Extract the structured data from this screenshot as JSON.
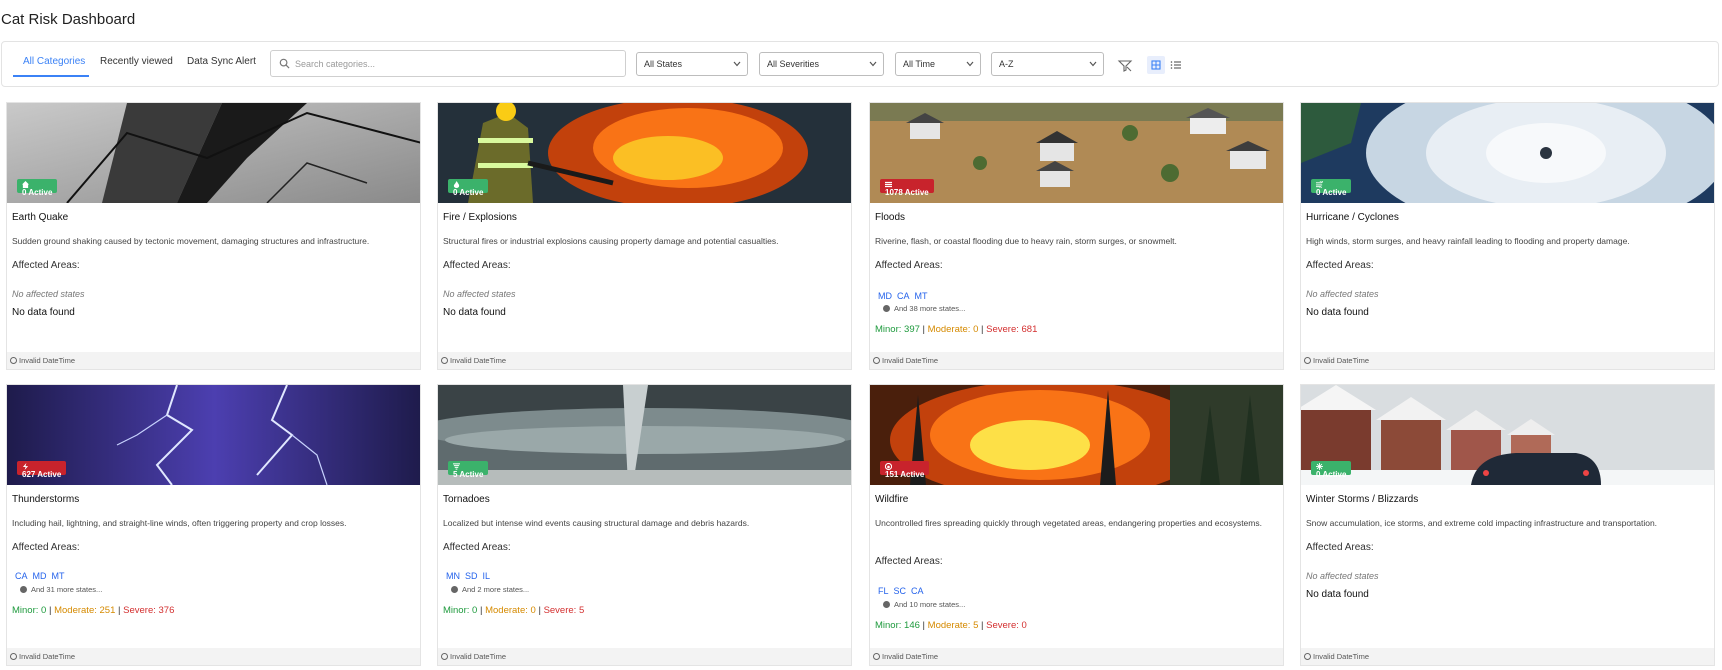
{
  "page": {
    "title": "Cat Risk Dashboard"
  },
  "tabs": [
    {
      "label": "All Categories",
      "active": true
    },
    {
      "label": "Recently viewed",
      "active": false
    },
    {
      "label": "Data Sync Alert",
      "active": false
    }
  ],
  "search": {
    "placeholder": "Search categories...",
    "value": ""
  },
  "filters": {
    "states": "All States",
    "severities": "All Severities",
    "time": "All Time",
    "sort": "A-Z"
  },
  "icons": {
    "clear_filter": "filter-clear-icon",
    "grid_view": "grid-view-icon",
    "list_view": "list-view-icon"
  },
  "colors": {
    "accent": "#3b82f6",
    "badge_green": "#3bb26b",
    "badge_red": "#c8232c",
    "minor": "#1e9a3d",
    "moderate": "#d58a00",
    "severe": "#d32f2f",
    "state_link": "#2563eb"
  },
  "labels": {
    "affected_areas": "Affected Areas:",
    "no_affected": "No affected states",
    "no_data": "No data found",
    "footer": "Invalid DateTime",
    "minor": "Minor:",
    "moderate": "Moderate:",
    "severe": "Severe:"
  },
  "cards": [
    {
      "title": "Earth Quake",
      "badge": "0 Active",
      "badge_color": "green",
      "badge_icon": "house-icon",
      "description": "Sudden ground shaking caused by tectonic movement, damaging structures and infrastructure."
    },
    {
      "title": "Fire / Explosions",
      "badge": "0 Active",
      "badge_color": "green",
      "badge_icon": "flame-icon",
      "description": "Structural fires or industrial explosions causing property damage and potential casualties."
    },
    {
      "title": "Floods",
      "badge": "1078 Active",
      "badge_color": "red",
      "badge_icon": "water-icon",
      "description": "Riverine, flash, or coastal flooding due to heavy rain, storm surges, or snowmelt.",
      "states": [
        "MD",
        "CA",
        "MT"
      ],
      "more": "And 38 more states...",
      "minor": "397",
      "moderate": "0",
      "severe": "681"
    },
    {
      "title": "Hurricane / Cyclones",
      "badge": "0 Active",
      "badge_color": "green",
      "badge_icon": "wind-icon",
      "description": "High winds, storm surges, and heavy rainfall leading to flooding and property damage."
    },
    {
      "title": "Thunderstorms",
      "badge": "627 Active",
      "badge_color": "red",
      "badge_icon": "bolt-icon",
      "description": "Including hail, lightning, and straight-line winds, often triggering property and crop losses.",
      "states": [
        "CA",
        "MD",
        "MT"
      ],
      "more": "And 31 more states...",
      "minor": "0",
      "moderate": "251",
      "severe": "376"
    },
    {
      "title": "Tornadoes",
      "badge": "5 Active",
      "badge_color": "green",
      "badge_icon": "tornado-icon",
      "description": "Localized but intense wind events causing structural damage and debris hazards.",
      "states": [
        "MN",
        "SD",
        "IL"
      ],
      "more": "And 2 more states...",
      "minor": "0",
      "moderate": "0",
      "severe": "5"
    },
    {
      "title": "Wildfire",
      "badge": "151 Active",
      "badge_color": "red",
      "badge_icon": "fire-icon",
      "description": "Uncontrolled fires spreading quickly through vegetated areas, endangering properties and ecosystems.",
      "states": [
        "FL",
        "SC",
        "CA"
      ],
      "more": "And 10 more states...",
      "minor": "146",
      "moderate": "5",
      "severe": "0"
    },
    {
      "title": "Winter Storms / Blizzards",
      "badge": "0 Active",
      "badge_color": "green",
      "badge_icon": "snowflake-icon",
      "description": "Snow accumulation, ice storms, and extreme cold impacting infrastructure and transportation."
    }
  ]
}
